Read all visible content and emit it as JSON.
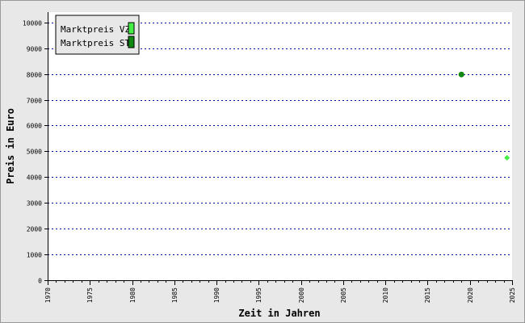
{
  "chart_data": {
    "type": "scatter",
    "xlabel": "Zeit in Jahren",
    "ylabel": "Preis in Euro",
    "xlim": [
      1970,
      2025
    ],
    "ylim": [
      0,
      10400
    ],
    "x_ticks": [
      1970,
      1975,
      1980,
      1985,
      1990,
      1995,
      2000,
      2005,
      2010,
      2015,
      2020,
      2025
    ],
    "y_ticks": [
      0,
      1000,
      2000,
      3000,
      4000,
      5000,
      6000,
      7000,
      8000,
      9000,
      10000
    ],
    "grid": {
      "horizontal": true,
      "style": "dotted",
      "color": "#0000aa"
    },
    "legend_position": "top-left",
    "series": [
      {
        "name": "Marktpreis VZ",
        "color": "#44ee44",
        "marker": "diamond",
        "points": [
          {
            "x": 2024.4,
            "y": 4750
          }
        ]
      },
      {
        "name": "Marktpreis ST",
        "color": "#118811",
        "marker": "circle",
        "points": [
          {
            "x": 2019.0,
            "y": 7980
          }
        ]
      }
    ]
  }
}
